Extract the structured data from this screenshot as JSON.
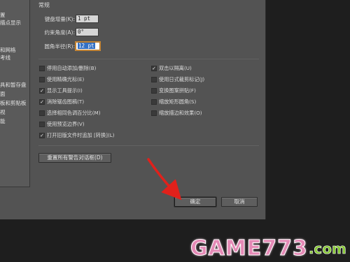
{
  "left_nav": {
    "items": [
      "置",
      "描点显示",
      "和网格",
      "考线",
      "具和暂存盘",
      "面",
      "板和剪贴板",
      "视",
      "能"
    ]
  },
  "section": {
    "title": "常规"
  },
  "fields": {
    "keyboard_increment": {
      "label": "键盘增量(K):",
      "value": "1 pt"
    },
    "constrain_angle": {
      "label": "约束角度(A):",
      "value": "0°"
    },
    "corner_radius": {
      "label": "圆角半径(R):",
      "value": "12 pt"
    }
  },
  "checkboxes_left": [
    {
      "label": "停用自动添加/删除(B)",
      "checked": false
    },
    {
      "label": "使用精确光标(E)",
      "checked": false
    },
    {
      "label": "显示工具提示(I)",
      "checked": true
    },
    {
      "label": "消除锯齿图稿(T)",
      "checked": true
    },
    {
      "label": "选择相同色调百分比(M)",
      "checked": false
    },
    {
      "label": "使用预览边界(V)",
      "checked": false
    }
  ],
  "checkboxes_right": [
    {
      "label": "双击以隔离(U)",
      "checked": true
    },
    {
      "label": "使用日式裁剪标记(J)",
      "checked": false
    },
    {
      "label": "变换图案拼贴(F)",
      "checked": false
    },
    {
      "label": "缩放矩形圆角(S)",
      "checked": false
    },
    {
      "label": "缩放描边和效果(O)",
      "checked": false
    }
  ],
  "checkbox_open_legacy": {
    "label": "打开旧版文件时追加 [转换](L)",
    "checked": true
  },
  "buttons": {
    "reset_warnings": "重置所有警告对话框(D)",
    "ok": "确定",
    "cancel": "取消"
  },
  "watermark": {
    "main": "GAME773",
    "suffix": ".com"
  },
  "colors": {
    "annotation_arrow": "#e0211b",
    "watermark_text": "#e58ab6",
    "watermark_suffix": "#86c833"
  }
}
